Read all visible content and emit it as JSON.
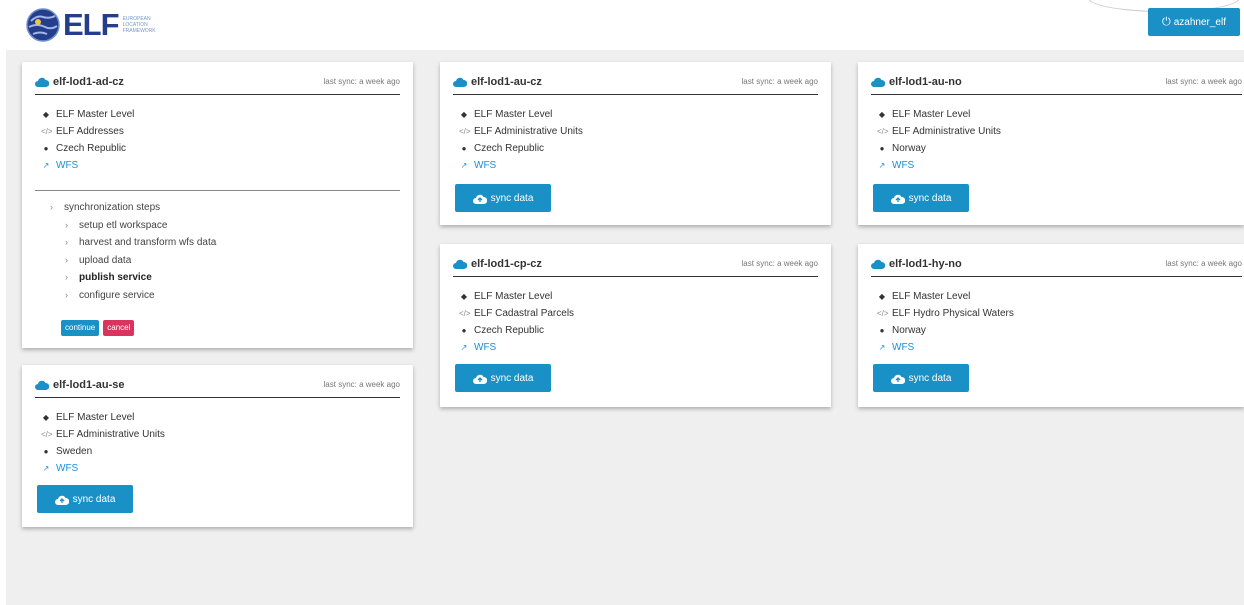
{
  "header": {
    "logo_text": "ELF",
    "logo_tagline": [
      "EUROPEAN",
      "LOCATION",
      "FRAMEWORK"
    ],
    "user_label": "azahner_elf",
    "user_icon": "power-icon"
  },
  "colors": {
    "accent": "#1a91c6",
    "danger": "#d9345e",
    "brand": "#243e8c",
    "link": "#1a8fd6"
  },
  "cards": [
    {
      "id": "elf-lod1-ad-cz",
      "title": "elf-lod1-ad-cz",
      "last_sync": "last sync: a week ago",
      "level": "ELF Master Level",
      "dataset": "ELF Addresses",
      "country": "Czech Republic",
      "service": "WFS",
      "steps_title": "synchronization steps",
      "steps": [
        "setup etl workspace",
        "harvest and transform wfs data",
        "upload data",
        "publish service",
        "configure service"
      ],
      "continue_label": "continue",
      "cancel_label": "cancel"
    },
    {
      "id": "elf-lod1-au-se",
      "title": "elf-lod1-au-se",
      "last_sync": "last sync: a week ago",
      "level": "ELF Master Level",
      "dataset": "ELF Administrative Units",
      "country": "Sweden",
      "service": "WFS",
      "sync_label": "sync data"
    },
    {
      "id": "elf-lod1-au-cz",
      "title": "elf-lod1-au-cz",
      "last_sync": "last sync: a week ago",
      "level": "ELF Master Level",
      "dataset": "ELF Administrative Units",
      "country": "Czech Republic",
      "service": "WFS",
      "sync_label": "sync data"
    },
    {
      "id": "elf-lod1-cp-cz",
      "title": "elf-lod1-cp-cz",
      "last_sync": "last sync: a week ago",
      "level": "ELF Master Level",
      "dataset": "ELF Cadastral Parcels",
      "country": "Czech Republic",
      "service": "WFS",
      "sync_label": "sync data"
    },
    {
      "id": "elf-lod1-au-no",
      "title": "elf-lod1-au-no",
      "last_sync": "last sync: a week ago",
      "level": "ELF Master Level",
      "dataset": "ELF Administrative Units",
      "country": "Norway",
      "service": "WFS",
      "sync_label": "sync data"
    },
    {
      "id": "elf-lod1-hy-no",
      "title": "elf-lod1-hy-no",
      "last_sync": "last sync: a week ago",
      "level": "ELF Master Level",
      "dataset": "ELF Hydro Physical Waters",
      "country": "Norway",
      "service": "WFS",
      "sync_label": "sync data"
    }
  ]
}
